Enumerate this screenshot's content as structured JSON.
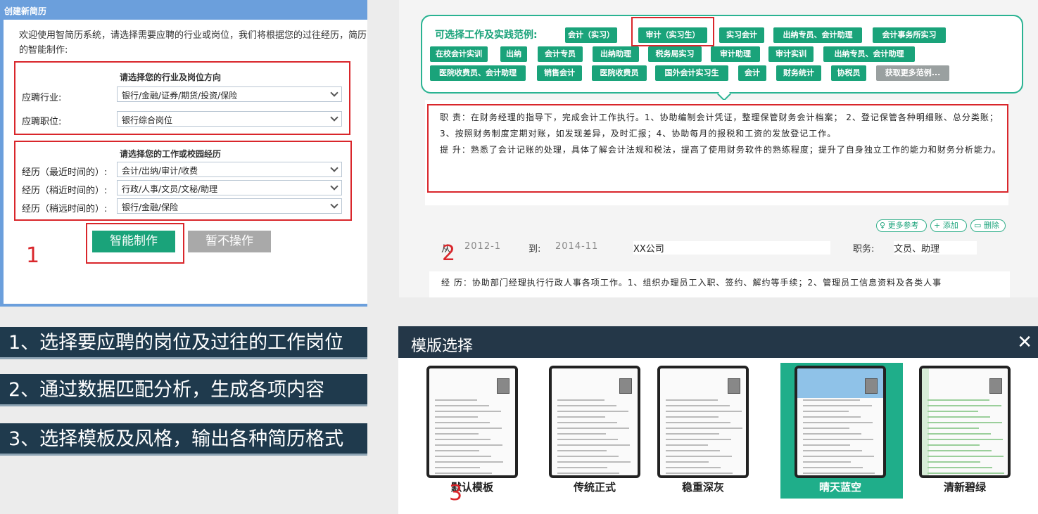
{
  "panel1": {
    "title": "创建新简历",
    "intro": "欢迎使用智简历系统，请选择需要应聘的行业或岗位，我们将根据您的过往经历，简历的智能制作:",
    "section1_title": "请选择您的行业及岗位方向",
    "industry_label": "应聘行业:",
    "industry_value": "银行/金融/证券/期货/投资/保险",
    "position_label": "应聘职位:",
    "position_value": "银行综合岗位",
    "section2_title": "请选择您的工作或校园经历",
    "exp1_label": "经历（最近时间的）:",
    "exp1_value": "会计/出纳/审计/收费",
    "exp2_label": "经历（稍近时间的）:",
    "exp2_value": "行政/人事/文员/文秘/助理",
    "exp3_label": "经历（稍远时间的）:",
    "exp3_value": "银行/金融/保险",
    "primary_button": "智能制作",
    "secondary_button": "暂不操作",
    "step_number": "1"
  },
  "panel2": {
    "caption": "可选择工作及实践范例:",
    "tags": [
      "会计（实习）",
      "审计（实习生）",
      "实习会计",
      "出纳专员、会计助理",
      "会计事务所实习",
      "在校会计实训",
      "出纳",
      "会计专员",
      "出纳助理",
      "税务局实习",
      "审计助理",
      "审计实训",
      "出纳专员、会计助理",
      "医院收费员、会计助理",
      "销售会计",
      "医院收费员",
      "国外会计实习生",
      "会计",
      "财务统计",
      "协税员",
      "获取更多范例..."
    ],
    "duty_text": "职 责：在财务经理的指导下，完成会计工作执行。1、协助编制会计凭证，整理保管财务会计档案； 2、登记保管各种明细账、总分类账； 3、按照财务制度定期对账，如发现差异，及时汇报；4、协助每月的报税和工资的发放登记工作。",
    "improve_text": "提 升：熟悉了会计记账的处理，具体了解会计法规和税法，提高了使用财务软件的熟练程度；提升了自身独立工作的能力和财务分析能力。",
    "more_ref": "更多参考",
    "add": "添加",
    "delete": "删除",
    "from_label": "从:",
    "from_value": "2012-1",
    "to_label": "到:",
    "to_value": "2014-11",
    "company": "XX公司",
    "job_label": "职务:",
    "job_value": "文员、助理",
    "exp_text": "经 历：协助部门经理执行行政人事各项工作。1、组织办理员工入职、签约、解约等手续；2、管理员工信息资料及各类人事",
    "step_number": "2"
  },
  "banners": [
    "1、选择要应聘的岗位及过往的工作岗位",
    "2、通过数据匹配分析，生成各项内容",
    "3、选择模板及风格，输出各种简历格式"
  ],
  "panel3": {
    "title": "模版选择",
    "templates": [
      "默认模板",
      "传统正式",
      "稳重深灰",
      "晴天蓝空",
      "清新碧绿"
    ],
    "selected": "晴天蓝空",
    "step_number": "3"
  },
  "colors": {
    "accent": "#1aa37a",
    "highlight_red": "#d9262b",
    "banner_bg": "#1f3a4d"
  }
}
